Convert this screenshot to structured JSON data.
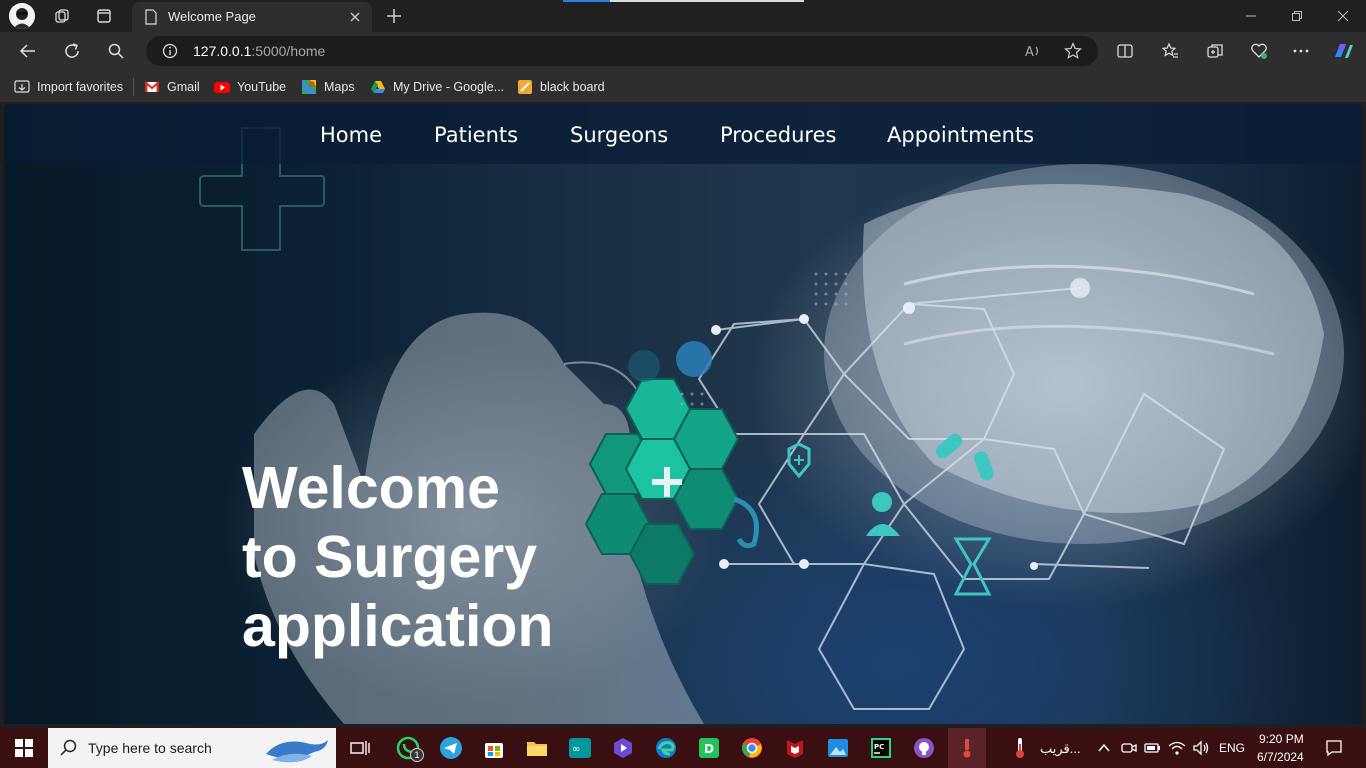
{
  "browser": {
    "tab": {
      "title": "Welcome Page"
    },
    "address": {
      "host": "127.0.0.1",
      "path": ":5000/home"
    },
    "favorites": [
      {
        "label": "Import favorites",
        "icon": "import-icon"
      },
      {
        "label": "Gmail",
        "icon": "gmail-icon"
      },
      {
        "label": "YouTube",
        "icon": "youtube-icon"
      },
      {
        "label": "Maps",
        "icon": "maps-icon"
      },
      {
        "label": "My Drive - Google...",
        "icon": "drive-icon"
      },
      {
        "label": "black board",
        "icon": "blackboard-icon"
      }
    ]
  },
  "page": {
    "nav": [
      "Home",
      "Patients",
      "Surgeons",
      "Procedures",
      "Appointments"
    ],
    "hero": {
      "line1": "Welcome",
      "line2": "to Surgery",
      "line3": "application"
    }
  },
  "taskbar": {
    "search_placeholder": "Type here to search",
    "whatsapp_badge": "1",
    "weather_text": "قريب...",
    "language": "ENG",
    "time": "9:20 PM",
    "date": "6/7/2024"
  },
  "colors": {
    "accent_teal": "#19b79a",
    "hex_line": "#d8e4ee",
    "taskbar_bg": "#3a0f12"
  }
}
